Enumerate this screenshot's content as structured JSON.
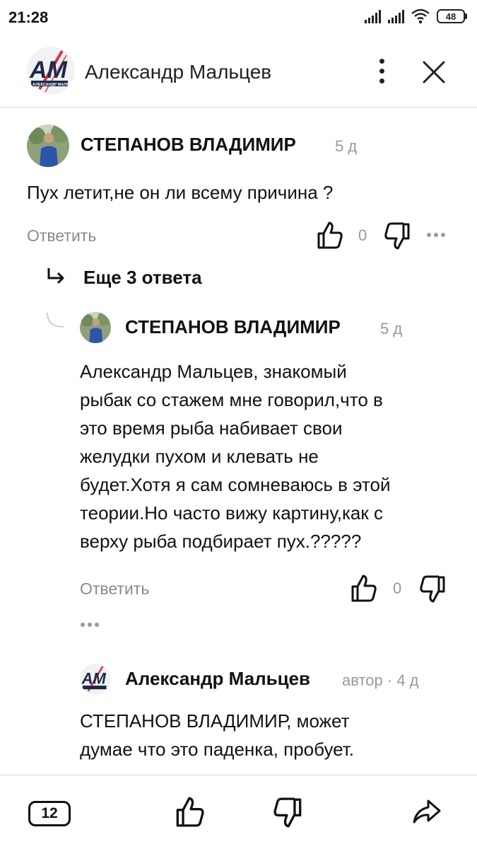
{
  "status_bar": {
    "time": "21:28",
    "battery": "48"
  },
  "header": {
    "channel_name": "Александр Мальцев",
    "logo_text": "АМ",
    "logo_subtext": "АЛЕКСАНДР МАЛЬЦЕВ"
  },
  "comments": [
    {
      "author": "СТЕПАНОВ ВЛАДИМИР",
      "age": "5 д",
      "text": "Пух летит,не он ли всему причина ?",
      "reply_label": "Ответить",
      "like_count": "0"
    }
  ],
  "thread": {
    "more_replies_label": "Еще 3 ответа"
  },
  "replies": [
    {
      "author": "СТЕПАНОВ ВЛАДИМИР",
      "age": "5 д",
      "lines": [
        "Александр Мальцев, знакомый",
        "рыбак со стажем мне говорил,что в",
        "это время рыба набивает свои",
        "желудки пухом и клевать не",
        "будет.Хотя я сам сомневаюсь в этой",
        "теории.Но часто вижу картину,как с",
        "верху рыба подбирает пух.?????"
      ],
      "reply_label": "Ответить",
      "like_count": "0"
    },
    {
      "author": "Александр Мальцев",
      "author_badge": "автор",
      "separator": "·",
      "age": "4 д",
      "lines": [
        "СТЕПАНОВ ВЛАДИМИР, может",
        "думае что это паденка, пробует."
      ]
    }
  ],
  "bottom_bar": {
    "comment_count": "12"
  },
  "colors": {
    "text": "#111111",
    "muted": "#999999",
    "divider": "#d6d6d6",
    "logo_red": "#d0021b",
    "logo_navy": "#1b2a4a"
  }
}
